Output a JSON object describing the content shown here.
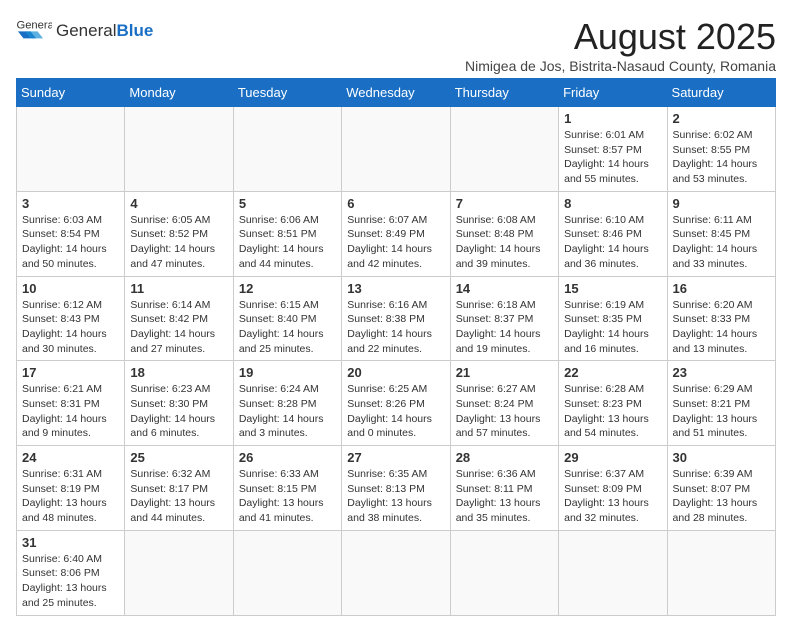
{
  "header": {
    "logo_general": "General",
    "logo_blue": "Blue",
    "month_title": "August 2025",
    "subtitle": "Nimigea de Jos, Bistrita-Nasaud County, Romania"
  },
  "days_of_week": [
    "Sunday",
    "Monday",
    "Tuesday",
    "Wednesday",
    "Thursday",
    "Friday",
    "Saturday"
  ],
  "weeks": [
    {
      "days": [
        {
          "num": "",
          "info": ""
        },
        {
          "num": "",
          "info": ""
        },
        {
          "num": "",
          "info": ""
        },
        {
          "num": "",
          "info": ""
        },
        {
          "num": "",
          "info": ""
        },
        {
          "num": "1",
          "info": "Sunrise: 6:01 AM\nSunset: 8:57 PM\nDaylight: 14 hours and 55 minutes."
        },
        {
          "num": "2",
          "info": "Sunrise: 6:02 AM\nSunset: 8:55 PM\nDaylight: 14 hours and 53 minutes."
        }
      ]
    },
    {
      "days": [
        {
          "num": "3",
          "info": "Sunrise: 6:03 AM\nSunset: 8:54 PM\nDaylight: 14 hours and 50 minutes."
        },
        {
          "num": "4",
          "info": "Sunrise: 6:05 AM\nSunset: 8:52 PM\nDaylight: 14 hours and 47 minutes."
        },
        {
          "num": "5",
          "info": "Sunrise: 6:06 AM\nSunset: 8:51 PM\nDaylight: 14 hours and 44 minutes."
        },
        {
          "num": "6",
          "info": "Sunrise: 6:07 AM\nSunset: 8:49 PM\nDaylight: 14 hours and 42 minutes."
        },
        {
          "num": "7",
          "info": "Sunrise: 6:08 AM\nSunset: 8:48 PM\nDaylight: 14 hours and 39 minutes."
        },
        {
          "num": "8",
          "info": "Sunrise: 6:10 AM\nSunset: 8:46 PM\nDaylight: 14 hours and 36 minutes."
        },
        {
          "num": "9",
          "info": "Sunrise: 6:11 AM\nSunset: 8:45 PM\nDaylight: 14 hours and 33 minutes."
        }
      ]
    },
    {
      "days": [
        {
          "num": "10",
          "info": "Sunrise: 6:12 AM\nSunset: 8:43 PM\nDaylight: 14 hours and 30 minutes."
        },
        {
          "num": "11",
          "info": "Sunrise: 6:14 AM\nSunset: 8:42 PM\nDaylight: 14 hours and 27 minutes."
        },
        {
          "num": "12",
          "info": "Sunrise: 6:15 AM\nSunset: 8:40 PM\nDaylight: 14 hours and 25 minutes."
        },
        {
          "num": "13",
          "info": "Sunrise: 6:16 AM\nSunset: 8:38 PM\nDaylight: 14 hours and 22 minutes."
        },
        {
          "num": "14",
          "info": "Sunrise: 6:18 AM\nSunset: 8:37 PM\nDaylight: 14 hours and 19 minutes."
        },
        {
          "num": "15",
          "info": "Sunrise: 6:19 AM\nSunset: 8:35 PM\nDaylight: 14 hours and 16 minutes."
        },
        {
          "num": "16",
          "info": "Sunrise: 6:20 AM\nSunset: 8:33 PM\nDaylight: 14 hours and 13 minutes."
        }
      ]
    },
    {
      "days": [
        {
          "num": "17",
          "info": "Sunrise: 6:21 AM\nSunset: 8:31 PM\nDaylight: 14 hours and 9 minutes."
        },
        {
          "num": "18",
          "info": "Sunrise: 6:23 AM\nSunset: 8:30 PM\nDaylight: 14 hours and 6 minutes."
        },
        {
          "num": "19",
          "info": "Sunrise: 6:24 AM\nSunset: 8:28 PM\nDaylight: 14 hours and 3 minutes."
        },
        {
          "num": "20",
          "info": "Sunrise: 6:25 AM\nSunset: 8:26 PM\nDaylight: 14 hours and 0 minutes."
        },
        {
          "num": "21",
          "info": "Sunrise: 6:27 AM\nSunset: 8:24 PM\nDaylight: 13 hours and 57 minutes."
        },
        {
          "num": "22",
          "info": "Sunrise: 6:28 AM\nSunset: 8:23 PM\nDaylight: 13 hours and 54 minutes."
        },
        {
          "num": "23",
          "info": "Sunrise: 6:29 AM\nSunset: 8:21 PM\nDaylight: 13 hours and 51 minutes."
        }
      ]
    },
    {
      "days": [
        {
          "num": "24",
          "info": "Sunrise: 6:31 AM\nSunset: 8:19 PM\nDaylight: 13 hours and 48 minutes."
        },
        {
          "num": "25",
          "info": "Sunrise: 6:32 AM\nSunset: 8:17 PM\nDaylight: 13 hours and 44 minutes."
        },
        {
          "num": "26",
          "info": "Sunrise: 6:33 AM\nSunset: 8:15 PM\nDaylight: 13 hours and 41 minutes."
        },
        {
          "num": "27",
          "info": "Sunrise: 6:35 AM\nSunset: 8:13 PM\nDaylight: 13 hours and 38 minutes."
        },
        {
          "num": "28",
          "info": "Sunrise: 6:36 AM\nSunset: 8:11 PM\nDaylight: 13 hours and 35 minutes."
        },
        {
          "num": "29",
          "info": "Sunrise: 6:37 AM\nSunset: 8:09 PM\nDaylight: 13 hours and 32 minutes."
        },
        {
          "num": "30",
          "info": "Sunrise: 6:39 AM\nSunset: 8:07 PM\nDaylight: 13 hours and 28 minutes."
        }
      ]
    },
    {
      "days": [
        {
          "num": "31",
          "info": "Sunrise: 6:40 AM\nSunset: 8:06 PM\nDaylight: 13 hours and 25 minutes."
        },
        {
          "num": "",
          "info": ""
        },
        {
          "num": "",
          "info": ""
        },
        {
          "num": "",
          "info": ""
        },
        {
          "num": "",
          "info": ""
        },
        {
          "num": "",
          "info": ""
        },
        {
          "num": "",
          "info": ""
        }
      ]
    }
  ]
}
